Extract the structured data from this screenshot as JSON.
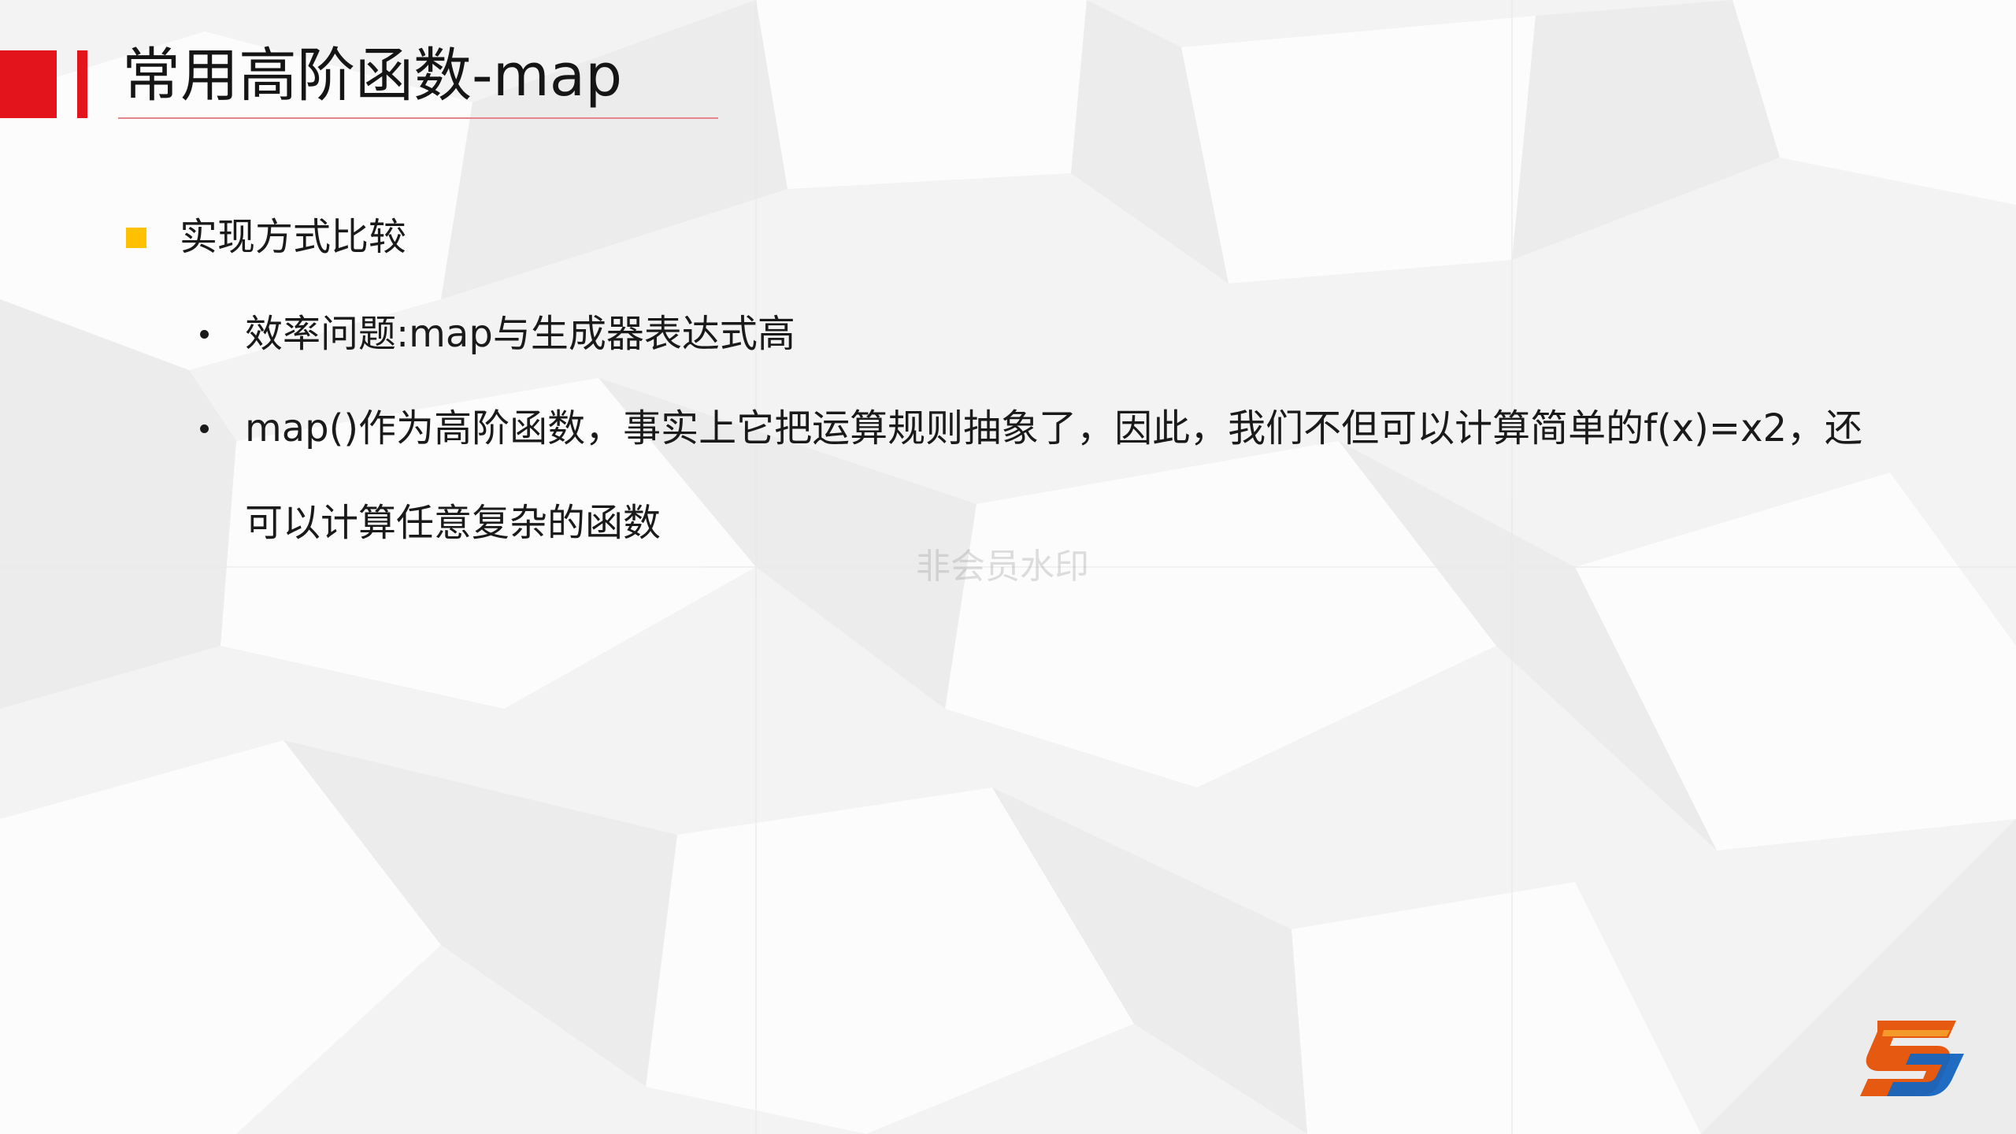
{
  "slide": {
    "title": "常用高阶函数-map",
    "accent_color": "#e3141c",
    "bullet_square_color": "#ffc000",
    "section": {
      "heading": "实现方式比较",
      "bullets": [
        "效率问题:map与生成器表达式高",
        "map()作为高阶函数，事实上它把运算规则抽象了，因此，我们不但可以计算简单的f(x)=x2，还可以计算任意复杂的函数"
      ]
    },
    "watermark": "非会员水印",
    "logo_icon": "s-logo-icon"
  }
}
